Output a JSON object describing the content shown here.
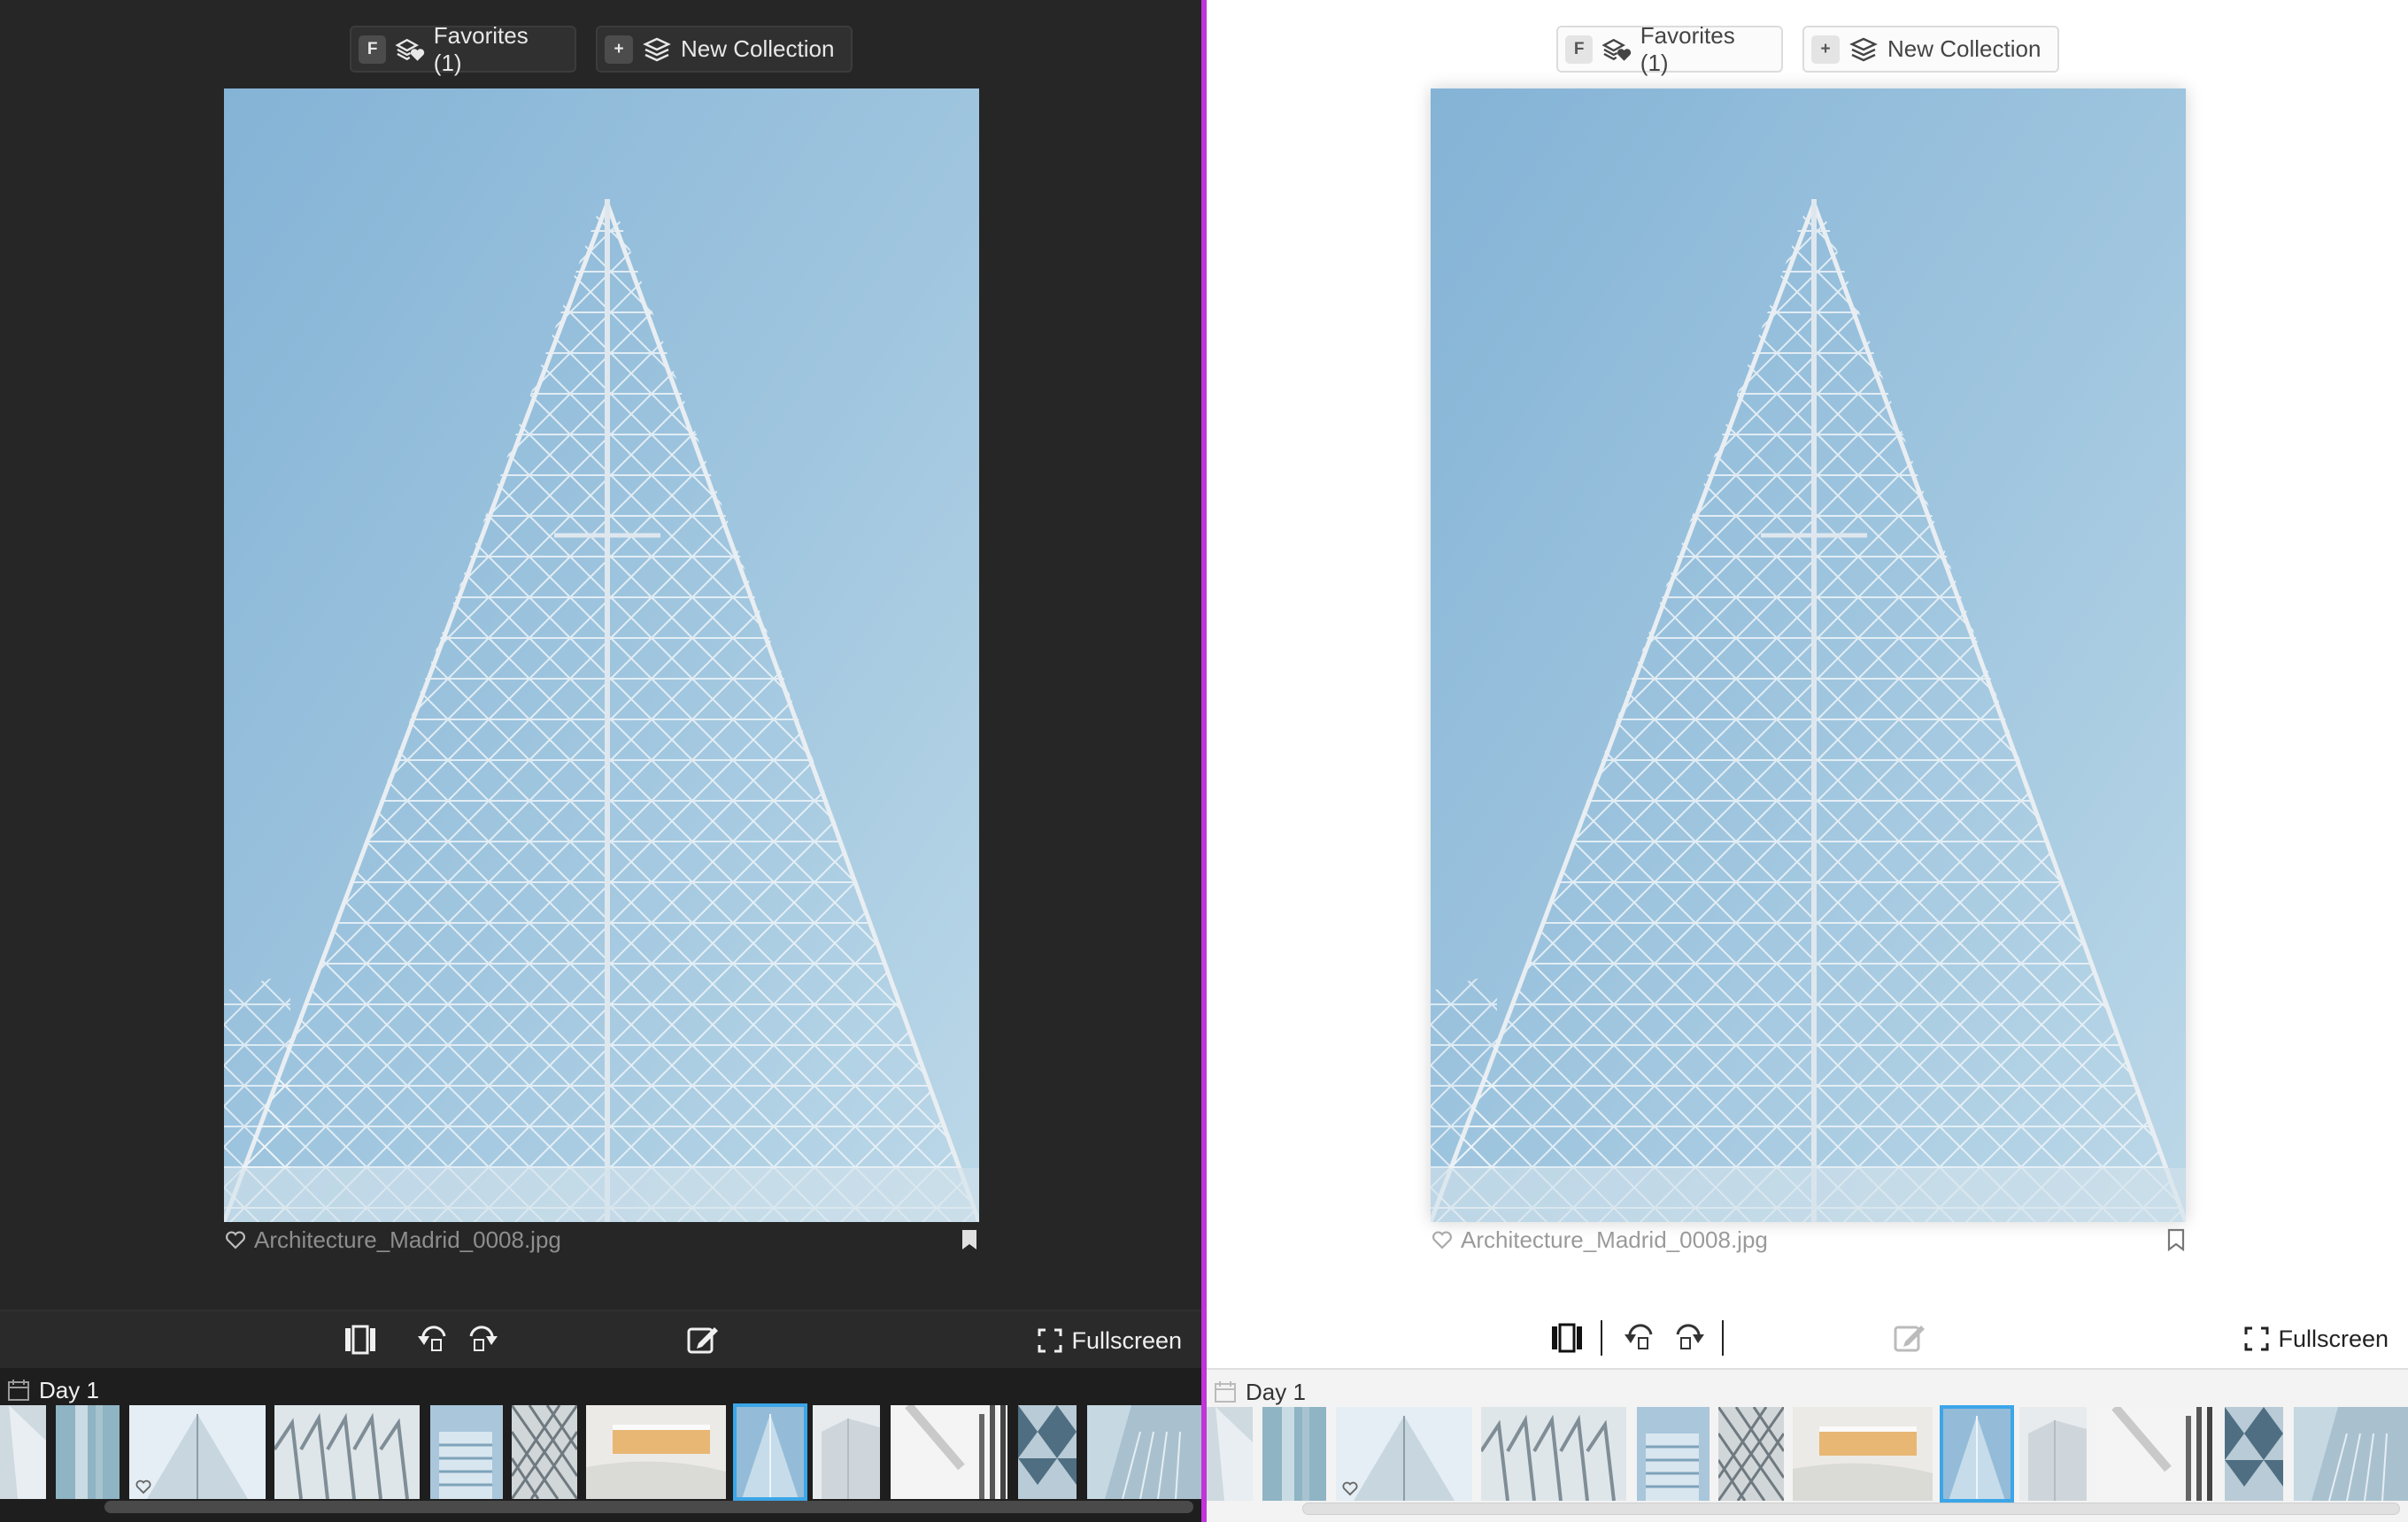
{
  "toolbar": {
    "favorites_key": "F",
    "favorites_label": "Favorites (1)",
    "new_collection_key": "+",
    "new_collection_label": "New Collection"
  },
  "photo": {
    "filename": "Architecture_Madrid_0008.jpg"
  },
  "bottom": {
    "fullscreen_label": "Fullscreen"
  },
  "filmstrip": {
    "group_label": "Day 1",
    "selected_index": 7,
    "favorite_index": 2
  },
  "colors": {
    "dark_bg": "#262626",
    "light_bg": "#ffffff",
    "selection_accent": "#3ba5e8",
    "splitter": "#c035d8",
    "sky": "#9cc4dd"
  },
  "icons": [
    "favorites-stack-icon",
    "collection-stack-icon",
    "heart-icon",
    "bookmark-icon",
    "compare-view-icon",
    "rotate-left-icon",
    "rotate-right-icon",
    "edit-icon",
    "fullscreen-icon",
    "calendar-icon"
  ]
}
